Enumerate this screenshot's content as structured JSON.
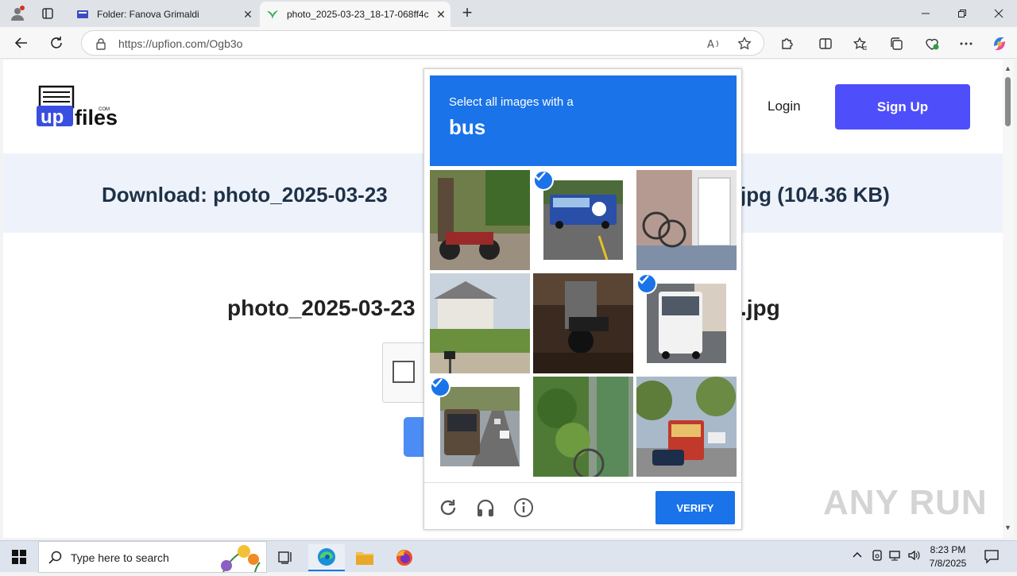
{
  "browser": {
    "tabs": [
      {
        "title": "Folder: Fanova Grimaldi",
        "close": "✕"
      },
      {
        "title": "photo_2025-03-23_18-17-068ff4c",
        "close": "✕"
      }
    ],
    "new_tab": "+",
    "url": "https://upfion.com/Ogb3o"
  },
  "site": {
    "logo_text": "up files",
    "logo_small": "COM",
    "login": "Login",
    "signup": "Sign Up",
    "download_left": "Download: photo_2025-03-23",
    "download_right": "jpg (104.36 KB)",
    "filename_left": "photo_2025-03-23",
    "filename_right": ".jpg"
  },
  "captcha": {
    "instruction": "Select all images with a",
    "object": "bus",
    "tiles": [
      {
        "name": "tile-motorcycle-tree",
        "selected": false
      },
      {
        "name": "tile-bus-blue",
        "selected": true
      },
      {
        "name": "tile-bicycles-door",
        "selected": false
      },
      {
        "name": "tile-house-mailbox",
        "selected": false
      },
      {
        "name": "tile-motorcycle-dark",
        "selected": false
      },
      {
        "name": "tile-bus-white-rear",
        "selected": true
      },
      {
        "name": "tile-bus-highway",
        "selected": true
      },
      {
        "name": "tile-bicycle-plants",
        "selected": false
      },
      {
        "name": "tile-bus-street",
        "selected": false
      }
    ],
    "verify": "VERIFY"
  },
  "watermark": "ANY RUN",
  "taskbar": {
    "search_placeholder": "Type here to search",
    "time": "8:23 PM",
    "date": "7/8/2025"
  },
  "colors": {
    "accent": "#1a73e8",
    "signup": "#4e4efb",
    "banner": "#eef3fb"
  }
}
